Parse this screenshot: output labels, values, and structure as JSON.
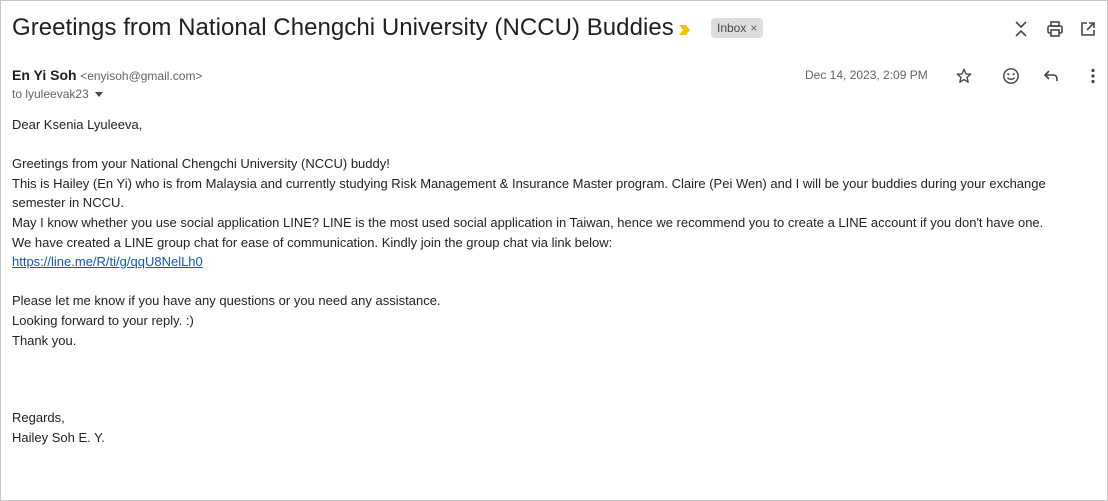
{
  "email": {
    "subject": "Greetings from National Chengchi University (NCCU) Buddies",
    "label": "Inbox",
    "label_remove": "×",
    "sender": {
      "name": "En Yi Soh",
      "email": "<enyisoh@gmail.com>"
    },
    "to": "to lyuleevak23",
    "date": "Dec 14, 2023, 2:09 PM"
  },
  "body": {
    "greeting": "Dear Ksenia Lyuleeva,",
    "p1": "Greetings from your National Chengchi University (NCCU) buddy!",
    "p2": "This is Hailey (En Yi) who is from Malaysia and currently studying Risk Management & Insurance Master program. Claire (Pei Wen) and I will be your buddies during your exchange semester in NCCU.",
    "p3": "May I know whether you use social application LINE? LINE is the most used social application in Taiwan, hence we recommend you to create a LINE account if you don't have one.",
    "p4": "We have created a LINE group chat for ease of communication. Kindly join the group chat via link below:",
    "link": "https://line.me/R/ti/g/qqU8NelLh0",
    "p5": "Please let me know if you have any questions or you need any assistance.",
    "p6": "Looking forward to your reply. :)",
    "p7": "Thank you.",
    "regards": "Regards,",
    "signature": "Hailey Soh E. Y."
  },
  "icons": {
    "importance": "importance-marker-icon",
    "collapse": "collapse-all-icon",
    "print": "print-icon",
    "open_new": "open-in-new-window-icon",
    "star": "star-icon",
    "emoji": "emoji-reaction-icon",
    "reply": "reply-icon",
    "more": "more-options-icon",
    "to_dropdown": "chevron-down-icon"
  },
  "colors": {
    "importance": "#f2c200",
    "link": "#1155cc",
    "chip_bg": "#dddddd"
  }
}
